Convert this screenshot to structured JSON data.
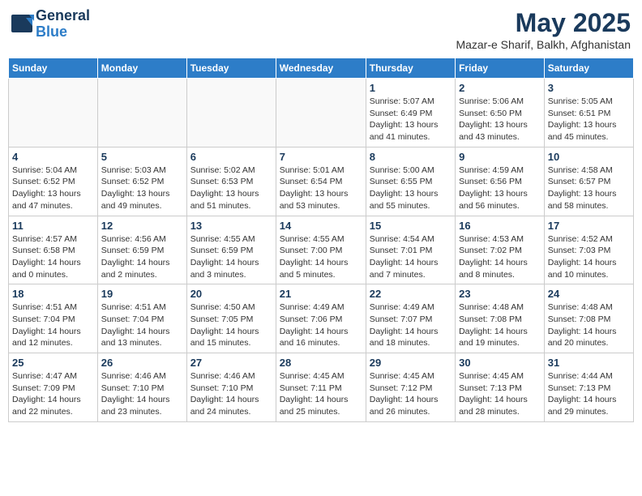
{
  "header": {
    "logo_line1": "General",
    "logo_line2": "Blue",
    "title": "May 2025",
    "subtitle": "Mazar-e Sharif, Balkh, Afghanistan"
  },
  "weekdays": [
    "Sunday",
    "Monday",
    "Tuesday",
    "Wednesday",
    "Thursday",
    "Friday",
    "Saturday"
  ],
  "weeks": [
    [
      {
        "day": "",
        "text": ""
      },
      {
        "day": "",
        "text": ""
      },
      {
        "day": "",
        "text": ""
      },
      {
        "day": "",
        "text": ""
      },
      {
        "day": "1",
        "text": "Sunrise: 5:07 AM\nSunset: 6:49 PM\nDaylight: 13 hours\nand 41 minutes."
      },
      {
        "day": "2",
        "text": "Sunrise: 5:06 AM\nSunset: 6:50 PM\nDaylight: 13 hours\nand 43 minutes."
      },
      {
        "day": "3",
        "text": "Sunrise: 5:05 AM\nSunset: 6:51 PM\nDaylight: 13 hours\nand 45 minutes."
      }
    ],
    [
      {
        "day": "4",
        "text": "Sunrise: 5:04 AM\nSunset: 6:52 PM\nDaylight: 13 hours\nand 47 minutes."
      },
      {
        "day": "5",
        "text": "Sunrise: 5:03 AM\nSunset: 6:52 PM\nDaylight: 13 hours\nand 49 minutes."
      },
      {
        "day": "6",
        "text": "Sunrise: 5:02 AM\nSunset: 6:53 PM\nDaylight: 13 hours\nand 51 minutes."
      },
      {
        "day": "7",
        "text": "Sunrise: 5:01 AM\nSunset: 6:54 PM\nDaylight: 13 hours\nand 53 minutes."
      },
      {
        "day": "8",
        "text": "Sunrise: 5:00 AM\nSunset: 6:55 PM\nDaylight: 13 hours\nand 55 minutes."
      },
      {
        "day": "9",
        "text": "Sunrise: 4:59 AM\nSunset: 6:56 PM\nDaylight: 13 hours\nand 56 minutes."
      },
      {
        "day": "10",
        "text": "Sunrise: 4:58 AM\nSunset: 6:57 PM\nDaylight: 13 hours\nand 58 minutes."
      }
    ],
    [
      {
        "day": "11",
        "text": "Sunrise: 4:57 AM\nSunset: 6:58 PM\nDaylight: 14 hours\nand 0 minutes."
      },
      {
        "day": "12",
        "text": "Sunrise: 4:56 AM\nSunset: 6:59 PM\nDaylight: 14 hours\nand 2 minutes."
      },
      {
        "day": "13",
        "text": "Sunrise: 4:55 AM\nSunset: 6:59 PM\nDaylight: 14 hours\nand 3 minutes."
      },
      {
        "day": "14",
        "text": "Sunrise: 4:55 AM\nSunset: 7:00 PM\nDaylight: 14 hours\nand 5 minutes."
      },
      {
        "day": "15",
        "text": "Sunrise: 4:54 AM\nSunset: 7:01 PM\nDaylight: 14 hours\nand 7 minutes."
      },
      {
        "day": "16",
        "text": "Sunrise: 4:53 AM\nSunset: 7:02 PM\nDaylight: 14 hours\nand 8 minutes."
      },
      {
        "day": "17",
        "text": "Sunrise: 4:52 AM\nSunset: 7:03 PM\nDaylight: 14 hours\nand 10 minutes."
      }
    ],
    [
      {
        "day": "18",
        "text": "Sunrise: 4:51 AM\nSunset: 7:04 PM\nDaylight: 14 hours\nand 12 minutes."
      },
      {
        "day": "19",
        "text": "Sunrise: 4:51 AM\nSunset: 7:04 PM\nDaylight: 14 hours\nand 13 minutes."
      },
      {
        "day": "20",
        "text": "Sunrise: 4:50 AM\nSunset: 7:05 PM\nDaylight: 14 hours\nand 15 minutes."
      },
      {
        "day": "21",
        "text": "Sunrise: 4:49 AM\nSunset: 7:06 PM\nDaylight: 14 hours\nand 16 minutes."
      },
      {
        "day": "22",
        "text": "Sunrise: 4:49 AM\nSunset: 7:07 PM\nDaylight: 14 hours\nand 18 minutes."
      },
      {
        "day": "23",
        "text": "Sunrise: 4:48 AM\nSunset: 7:08 PM\nDaylight: 14 hours\nand 19 minutes."
      },
      {
        "day": "24",
        "text": "Sunrise: 4:48 AM\nSunset: 7:08 PM\nDaylight: 14 hours\nand 20 minutes."
      }
    ],
    [
      {
        "day": "25",
        "text": "Sunrise: 4:47 AM\nSunset: 7:09 PM\nDaylight: 14 hours\nand 22 minutes."
      },
      {
        "day": "26",
        "text": "Sunrise: 4:46 AM\nSunset: 7:10 PM\nDaylight: 14 hours\nand 23 minutes."
      },
      {
        "day": "27",
        "text": "Sunrise: 4:46 AM\nSunset: 7:10 PM\nDaylight: 14 hours\nand 24 minutes."
      },
      {
        "day": "28",
        "text": "Sunrise: 4:45 AM\nSunset: 7:11 PM\nDaylight: 14 hours\nand 25 minutes."
      },
      {
        "day": "29",
        "text": "Sunrise: 4:45 AM\nSunset: 7:12 PM\nDaylight: 14 hours\nand 26 minutes."
      },
      {
        "day": "30",
        "text": "Sunrise: 4:45 AM\nSunset: 7:13 PM\nDaylight: 14 hours\nand 28 minutes."
      },
      {
        "day": "31",
        "text": "Sunrise: 4:44 AM\nSunset: 7:13 PM\nDaylight: 14 hours\nand 29 minutes."
      }
    ]
  ]
}
